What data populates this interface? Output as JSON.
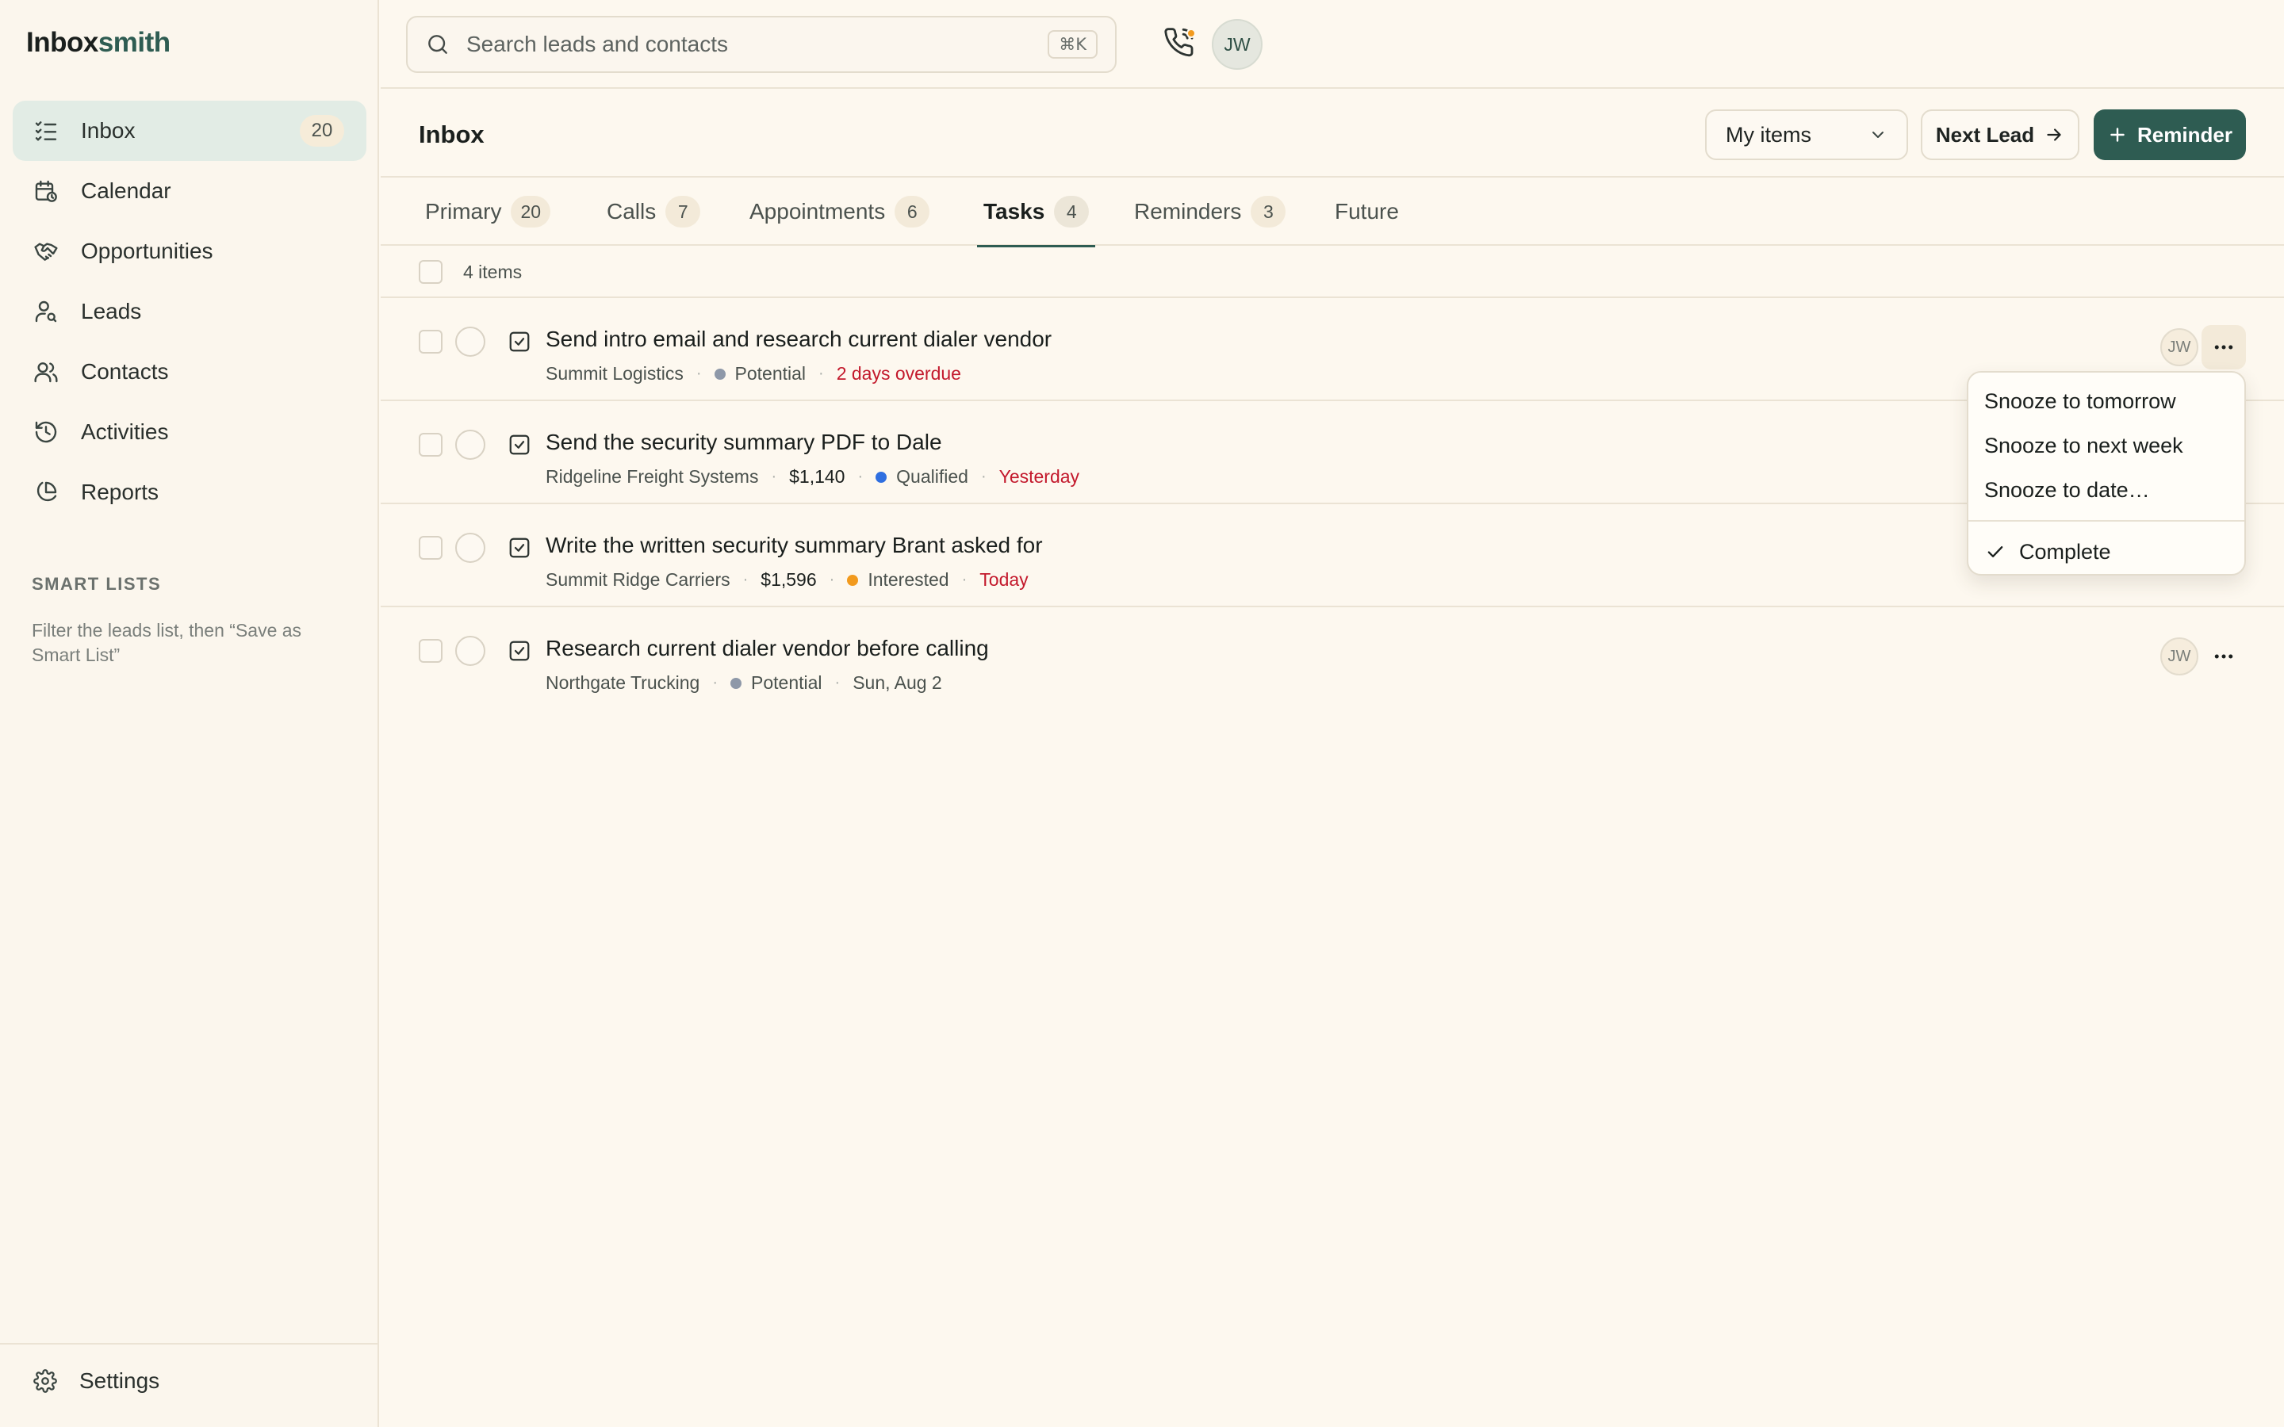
{
  "app": {
    "logo_primary": "Inbox",
    "logo_accent": "smith"
  },
  "sidebar": {
    "items": [
      {
        "label": "Inbox",
        "count": "20",
        "icon": "list-check-icon",
        "active": true
      },
      {
        "label": "Calendar",
        "icon": "calendar-clock-icon"
      },
      {
        "label": "Opportunities",
        "icon": "handshake-icon"
      },
      {
        "label": "Leads",
        "icon": "user-search-icon"
      },
      {
        "label": "Contacts",
        "icon": "users-icon"
      },
      {
        "label": "Activities",
        "icon": "history-icon"
      },
      {
        "label": "Reports",
        "icon": "pie-chart-icon"
      }
    ],
    "smart_lists_title": "SMART LISTS",
    "smart_lists_hint": "Filter the leads list, then “Save as Smart List”",
    "settings_label": "Settings"
  },
  "topbar": {
    "search_placeholder": "Search leads and contacts",
    "search_shortcut": "⌘K",
    "user_initials": "JW"
  },
  "header": {
    "title": "Inbox",
    "filter_select": "My items",
    "next_lead_label": "Next Lead",
    "reminder_label": "Reminder"
  },
  "tabs": [
    {
      "label": "Primary",
      "count": "20"
    },
    {
      "label": "Calls",
      "count": "7"
    },
    {
      "label": "Appointments",
      "count": "6"
    },
    {
      "label": "Tasks",
      "count": "4",
      "active": true
    },
    {
      "label": "Reminders",
      "count": "3"
    },
    {
      "label": "Future",
      "count": ""
    }
  ],
  "list": {
    "count_text": "4 items",
    "tasks": [
      {
        "title": "Send intro email and research current dialer vendor",
        "company": "Summit Logistics",
        "amount": "",
        "status": "Potential",
        "status_color": "#8e98a8",
        "due": "2 days overdue",
        "due_color": "#c3192c",
        "assignee": "JW"
      },
      {
        "title": "Send the security summary PDF to Dale",
        "company": "Ridgeline Freight Systems",
        "amount": "$1,140",
        "status": "Qualified",
        "status_color": "#2f6fe0",
        "due": "Yesterday",
        "due_color": "#c3192c",
        "assignee": "JW"
      },
      {
        "title": "Write the written security summary Brant asked for",
        "company": "Summit Ridge Carriers",
        "amount": "$1,596",
        "status": "Interested",
        "status_color": "#f29a1d",
        "due": "Today",
        "due_color": "#c3192c",
        "assignee": "JW"
      },
      {
        "title": "Research current dialer vendor before calling",
        "company": "Northgate Trucking",
        "amount": "",
        "status": "Potential",
        "status_color": "#8e98a8",
        "due": "Sun, Aug 2",
        "due_color": "#4b524e",
        "assignee": "JW"
      }
    ]
  },
  "dropdown": {
    "items": [
      "Snooze to tomorrow",
      "Snooze to next week",
      "Snooze to date…"
    ],
    "complete_label": "Complete"
  },
  "colors": {
    "accent": "#2e5c52",
    "background": "#fdf8ef",
    "overdue": "#c3192c"
  }
}
